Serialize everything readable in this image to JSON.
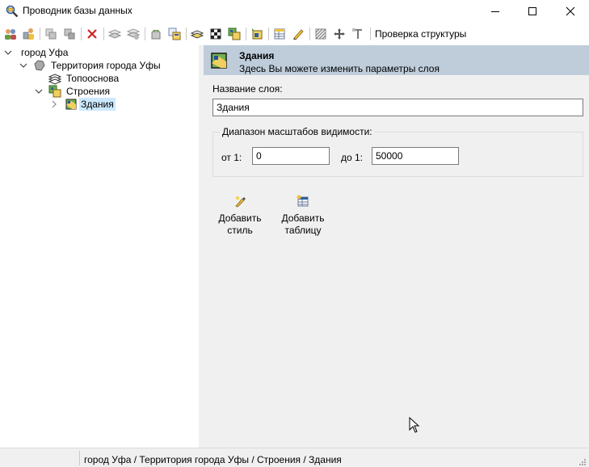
{
  "window": {
    "title": "Проводник базы данных",
    "icon": "magnifier-db-icon"
  },
  "toolbar": {
    "check_structure_label": "Проверка структуры",
    "icons": [
      "users-icon",
      "user-settings-icon",
      "copy-gray-icon",
      "paste-gray-icon",
      "delete-icon",
      "layers-gray-icon",
      "layers-gray2-icon",
      "bag-icon",
      "link-table-icon",
      "book-layer-icon",
      "checker-icon",
      "add-layers-icon",
      "import-icon",
      "table-icon",
      "pencil-icon",
      "hatch-icon",
      "move-icon",
      "text-tool-icon"
    ]
  },
  "tree": {
    "root": "город Уфа",
    "territory": "Территория города Уфы",
    "topo": "Топооснова",
    "buildings_group": "Строения",
    "buildings_layer": "Здания"
  },
  "panel": {
    "title": "Здания",
    "subtitle": "Здесь Вы можете изменить параметры слоя",
    "layer_name_label": "Название слоя:",
    "layer_name_value": "Здания",
    "scale_group_label": "Диапазон масштабов видимости:",
    "from_label": "от 1:",
    "from_value": "0",
    "to_label": "до 1:",
    "to_value": "50000",
    "add_style_label": "Добавить\nстиль",
    "add_table_label": "Добавить\nтаблицу"
  },
  "statusbar": {
    "path": "город Уфа / Территория города Уфы / Строения / Здания"
  },
  "colors": {
    "header_bg": "#bfcddb",
    "panel_bg": "#f0f0f0",
    "selection_bg": "#cce8ff",
    "delete_red": "#d32020"
  }
}
